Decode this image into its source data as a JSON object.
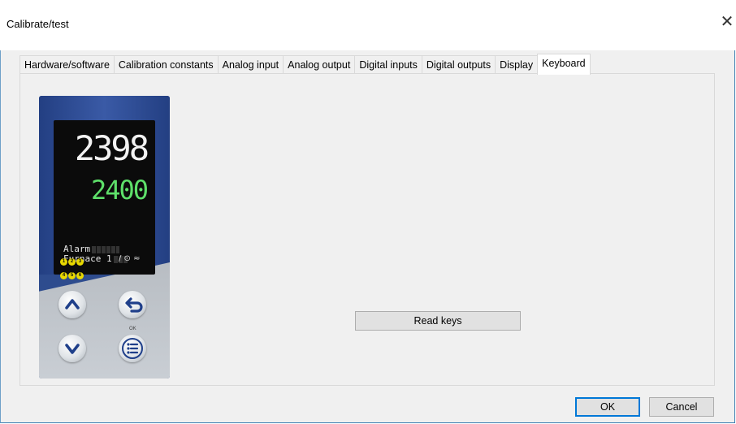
{
  "window": {
    "title": "Calibrate/test",
    "close_glyph": "✕"
  },
  "tabs": [
    {
      "label": "Hardware/software",
      "active": false
    },
    {
      "label": "Calibration constants",
      "active": false
    },
    {
      "label": "Analog input",
      "active": false
    },
    {
      "label": "Analog output",
      "active": false
    },
    {
      "label": "Digital inputs",
      "active": false
    },
    {
      "label": "Digital outputs",
      "active": false
    },
    {
      "label": "Display",
      "active": false
    },
    {
      "label": "Keyboard",
      "active": true
    }
  ],
  "device": {
    "process_value": "2398",
    "setpoint": "2400",
    "line1": "Alarm",
    "line2": "Furnace 1",
    "leds": [
      "1",
      "2",
      "3",
      "4",
      "5",
      "6"
    ],
    "status_icons": "/ ⊙ ≈",
    "ok_label": "OK",
    "keys": [
      "up-key",
      "back-key",
      "down-key",
      "menu-key"
    ],
    "colors": {
      "housing": "#2e4c8e",
      "lcd_main": "#f2f2f2",
      "lcd_setpoint": "#5ee06a",
      "led": "#e8d800",
      "key_icon": "#1f3f8a"
    }
  },
  "main": {
    "read_keys_label": "Read keys"
  },
  "footer": {
    "ok_label": "OK",
    "cancel_label": "Cancel"
  }
}
